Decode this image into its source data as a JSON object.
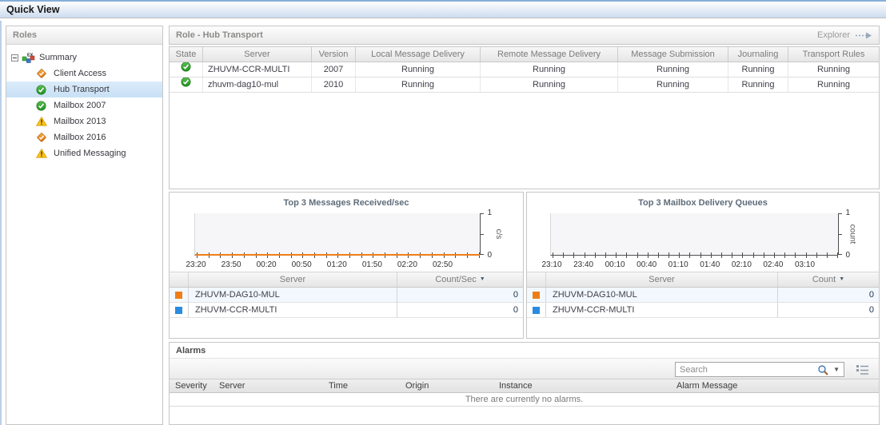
{
  "window": {
    "title": "Quick View"
  },
  "colors": {
    "selected_row": "#cbe2f6",
    "status_ok_green": "#2f9e2b",
    "warning_yellow": "#fdc116",
    "diamond_orange": "#e8820c",
    "series_orange": "#ee7d18",
    "series_blue": "#2b8be0"
  },
  "sidebar": {
    "title": "Roles",
    "tree": [
      {
        "label": "Summary",
        "icon": "exchange-summary-icon",
        "expander": "minus",
        "level": 0,
        "selected": false
      },
      {
        "label": "Client Access",
        "icon": "diamond-check-icon",
        "level": 1,
        "selected": false
      },
      {
        "label": "Hub Transport",
        "icon": "circle-check-icon",
        "level": 1,
        "selected": true
      },
      {
        "label": "Mailbox 2007",
        "icon": "circle-check-icon",
        "level": 1,
        "selected": false
      },
      {
        "label": "Mailbox 2013",
        "icon": "warning-icon",
        "level": 1,
        "selected": false
      },
      {
        "label": "Mailbox 2016",
        "icon": "diamond-check-icon",
        "level": 1,
        "selected": false
      },
      {
        "label": "Unified Messaging",
        "icon": "warning-icon",
        "level": 1,
        "selected": false
      }
    ]
  },
  "main": {
    "panel_title": "Role - Hub Transport",
    "explorer_label": "Explorer",
    "server_table": {
      "columns": [
        "State",
        "Server",
        "Version",
        "Local Message Delivery",
        "Remote Message Delivery",
        "Message Submission",
        "Journaling",
        "Transport Rules"
      ],
      "rows": [
        {
          "state": "ok",
          "cells": [
            "ZHUVM-CCR-MULTI",
            "2007",
            "Running",
            "Running",
            "Running",
            "Running",
            "Running"
          ]
        },
        {
          "state": "ok",
          "cells": [
            "zhuvm-dag10-mul",
            "2010",
            "Running",
            "Running",
            "Running",
            "Running",
            "Running"
          ]
        }
      ]
    },
    "alarms": {
      "title": "Alarms",
      "search_placeholder": "Search",
      "columns": [
        "Severity",
        "Server",
        "Time",
        "Origin",
        "Instance",
        "Alarm Message"
      ],
      "empty_message": "There are currently no alarms."
    }
  },
  "chart_data": [
    {
      "type": "line",
      "title": "Top 3 Messages Received/sec",
      "ylabel": "c/s",
      "ylim": [
        0,
        1
      ],
      "x": [
        "23:20",
        "23:50",
        "00:20",
        "00:50",
        "01:20",
        "01:50",
        "02:20",
        "02:50"
      ],
      "series": [
        {
          "name": "ZHUVM-DAG10-MUL",
          "color": "#ee7d18",
          "values": [
            0,
            0,
            0,
            0,
            0,
            0,
            0,
            0
          ]
        },
        {
          "name": "ZHUVM-CCR-MULTI",
          "color": "#2b8be0",
          "values": [
            0,
            0,
            0,
            0,
            0,
            0,
            0,
            0
          ]
        }
      ],
      "line_visible": true,
      "legend_table": {
        "columns": [
          "Server",
          "Count/Sec"
        ],
        "sorted_column": "Count/Sec",
        "rows": [
          {
            "color": "#ee7d18",
            "server": "ZHUVM-DAG10-MUL",
            "value": "0"
          },
          {
            "color": "#2b8be0",
            "server": "ZHUVM-CCR-MULTI",
            "value": "0"
          }
        ]
      }
    },
    {
      "type": "line",
      "title": "Top 3 Mailbox Delivery Queues",
      "ylabel": "count",
      "ylim": [
        0,
        1
      ],
      "x": [
        "23:10",
        "23:40",
        "00:10",
        "00:40",
        "01:10",
        "01:40",
        "02:10",
        "02:40",
        "03:10"
      ],
      "series": [
        {
          "name": "ZHUVM-DAG10-MUL",
          "color": "#ee7d18",
          "values": [
            0,
            0,
            0,
            0,
            0,
            0,
            0,
            0,
            0
          ]
        },
        {
          "name": "ZHUVM-CCR-MULTI",
          "color": "#2b8be0",
          "values": [
            0,
            0,
            0,
            0,
            0,
            0,
            0,
            0,
            0
          ]
        }
      ],
      "line_visible": false,
      "legend_table": {
        "columns": [
          "Server",
          "Count"
        ],
        "sorted_column": "Count",
        "rows": [
          {
            "color": "#ee7d18",
            "server": "ZHUVM-DAG10-MUL",
            "value": "0"
          },
          {
            "color": "#2b8be0",
            "server": "ZHUVM-CCR-MULTI",
            "value": "0"
          }
        ]
      }
    }
  ]
}
